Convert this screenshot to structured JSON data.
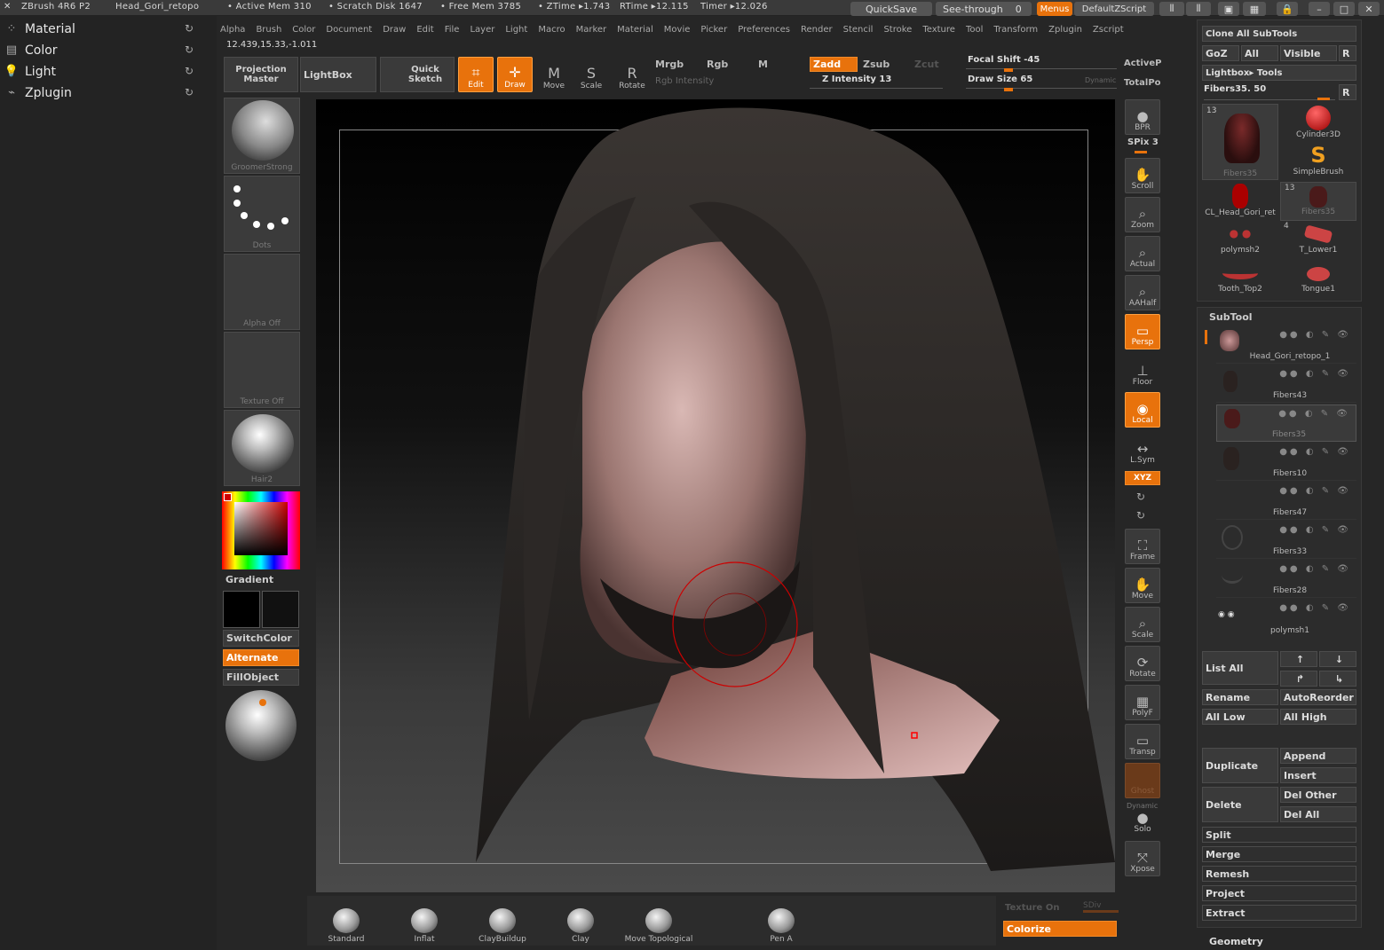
{
  "titlebar": {
    "app": "ZBrush 4R6 P2",
    "doc": "Head_Gori_retopo",
    "active_mem": "• Active Mem 310",
    "scratch": "• Scratch Disk 1647",
    "free_mem": "• Free Mem 3785",
    "ztime": "• ZTime ▸1.743",
    "rtime": "RTime ▸12.115",
    "timer": "Timer ▸12.026",
    "quicksave": "QuickSave",
    "seethrough": "See-through",
    "seethrough_val": "0",
    "menus": "Menus",
    "script": "DefaultZScript"
  },
  "menubar": [
    "Alpha",
    "Brush",
    "Color",
    "Document",
    "Draw",
    "Edit",
    "File",
    "Layer",
    "Light",
    "Macro",
    "Marker",
    "Material",
    "Movie",
    "Picker",
    "Preferences",
    "Render",
    "Stencil",
    "Stroke",
    "Texture",
    "Tool",
    "Transform",
    "Zplugin",
    "Zscript"
  ],
  "coords": "12.439,15.33,-1.011",
  "left_palettes": [
    {
      "label": "Material",
      "icon": "material-icon"
    },
    {
      "label": "Color",
      "icon": "color-icon"
    },
    {
      "label": "Light",
      "icon": "light-icon"
    },
    {
      "label": "Zplugin",
      "icon": "zplugin-icon"
    }
  ],
  "toolbar": {
    "projection_master": "Projection Master",
    "lightbox": "LightBox",
    "quick_sketch": "Quick Sketch",
    "edit": "Edit",
    "draw": "Draw",
    "move": "Move",
    "scale": "Scale",
    "rotate": "Rotate",
    "mrgb": "Mrgb",
    "rgb": "Rgb",
    "m": "M",
    "rgb_intensity": "Rgb Intensity",
    "zadd": "Zadd",
    "zsub": "Zsub",
    "zcut": "Zcut",
    "z_intensity": "Z Intensity 13",
    "focal_shift": "Focal Shift -45",
    "draw_size": "Draw Size 65",
    "dynamic": "Dynamic",
    "activep": "ActiveP",
    "totalp": "TotalPo"
  },
  "left_tray": {
    "brush": "GroomerStrong",
    "stroke": "Dots",
    "alpha": "Alpha Off",
    "texture": "Texture Off",
    "material": "Hair2",
    "gradient": "Gradient",
    "switchcolor": "SwitchColor",
    "alternate": "Alternate",
    "fillobject": "FillObject"
  },
  "right_tools": {
    "bpr": "BPR",
    "spix": "SPix 3",
    "scroll": "Scroll",
    "zoom": "Zoom",
    "actual": "Actual",
    "aahalf": "AAHalf",
    "persp": "Persp",
    "floor": "Floor",
    "local": "Local",
    "lsym": "L.Sym",
    "xyz": "XYZ",
    "frame": "Frame",
    "move": "Move",
    "scale": "Scale",
    "rotate": "Rotate",
    "polyf": "PolyF",
    "transp": "Transp",
    "ghost": "Ghost",
    "dynamic": "Dynamic",
    "solo": "Solo",
    "xpose": "Xpose"
  },
  "tool_panel": {
    "clone_all": "Clone All SubTools",
    "goz": "GoZ",
    "all": "All",
    "visible": "Visible",
    "r": "R",
    "lightbox_tools": "Lightbox▸ Tools",
    "current": "Fibers35. 50",
    "tools": [
      {
        "name": "Fibers35",
        "count": "13"
      },
      {
        "name": "Cylinder3D",
        "count": ""
      },
      {
        "name": "SimpleBrush",
        "count": ""
      },
      {
        "name": "CL_Head_Gori_ret",
        "count": ""
      },
      {
        "name": "Fibers35",
        "count": "13"
      },
      {
        "name": "polymsh2",
        "count": ""
      },
      {
        "name": "T_Lower1",
        "count": "4"
      },
      {
        "name": "Tooth_Top2",
        "count": ""
      },
      {
        "name": "Tongue1",
        "count": ""
      }
    ]
  },
  "subtool": {
    "title": "SubTool",
    "items": [
      "Head_Gori_retopo_1",
      "Fibers43",
      "Fibers35",
      "Fibers10",
      "Fibers47",
      "Fibers33",
      "Fibers28",
      "polymsh1"
    ],
    "selected": 2,
    "list_all": "List All",
    "rename": "Rename",
    "autoreorder": "AutoReorder",
    "all_low": "All Low",
    "all_high": "All High",
    "append": "Append",
    "duplicate": "Duplicate",
    "insert": "Insert",
    "del_other": "Del Other",
    "delete": "Delete",
    "del_all": "Del All",
    "split": "Split",
    "merge": "Merge",
    "remesh": "Remesh",
    "project": "Project",
    "extract": "Extract",
    "geometry": "Geometry"
  },
  "shelf": {
    "brushes": [
      "Standard",
      "Inflat",
      "ClayBuildup",
      "Clay",
      "Move Topological",
      "Pen A"
    ],
    "texture_on": "Texture On",
    "sdiv": "SDiv",
    "colorize": "Colorize"
  },
  "colors": {
    "accent": "#e8720c",
    "panel": "#3a3a3a",
    "bg": "#262626"
  }
}
